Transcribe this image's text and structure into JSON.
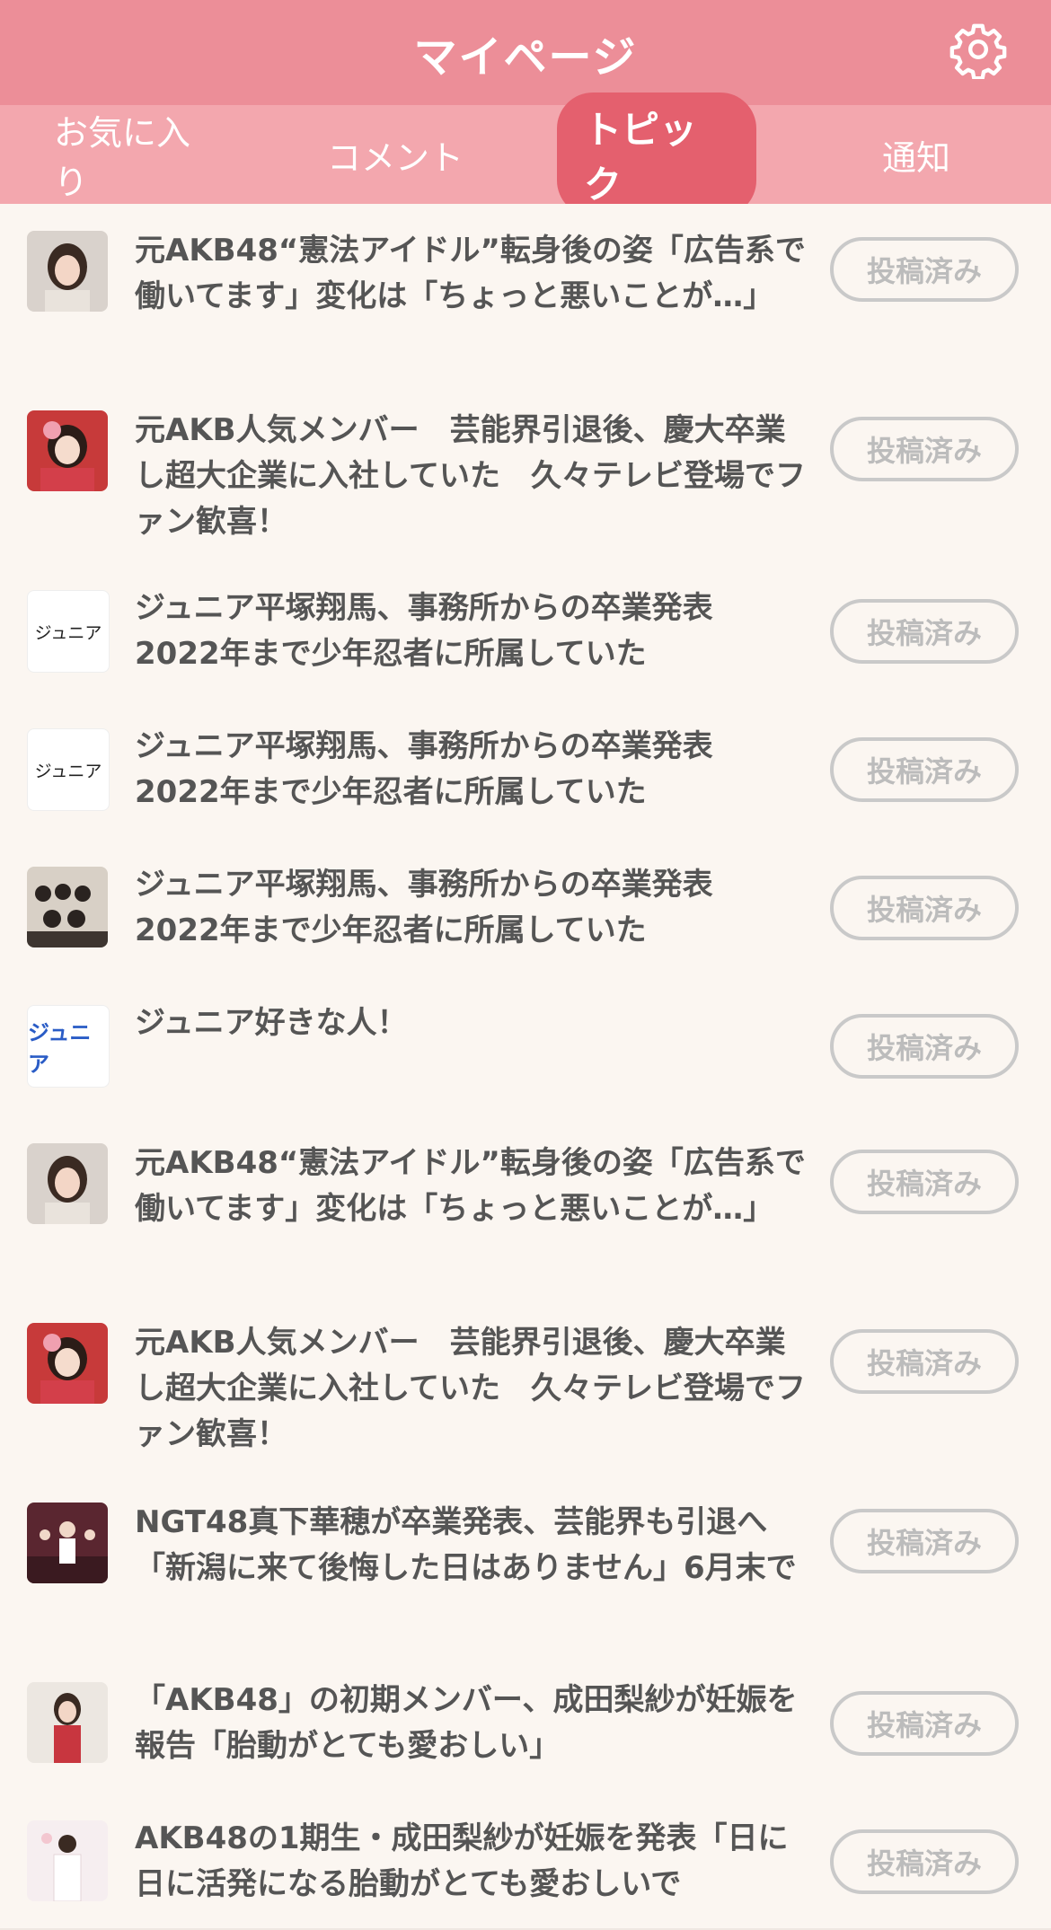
{
  "header": {
    "title": "マイページ",
    "settings_icon": "gear-icon"
  },
  "tabs": [
    {
      "label": "お気に入り",
      "active": false
    },
    {
      "label": "コメント",
      "active": false
    },
    {
      "label": "トピック",
      "active": true
    },
    {
      "label": "通知",
      "active": false
    }
  ],
  "colors": {
    "header": "#ec8e98",
    "tabbar": "#f3a7ae",
    "active_tab": "#e4606e"
  },
  "topics": [
    {
      "title": "元AKB48“憲法アイドル”転身後の姿「広告系で働いてます」変化は「ちょっと悪いことが…」",
      "button": "投稿済み",
      "thumb": "portrait-photo"
    },
    {
      "title": "元AKB人気メンバー　芸能界引退後、慶大卒業し超大企業に入社していた　久々テレビ登場でファン歓喜！",
      "button": "投稿済み",
      "thumb": "portrait-photo"
    },
    {
      "title": "ジュニア平塚翔馬、事務所からの卒業発表 2022年まで少年忍者に所属していた",
      "button": "投稿済み",
      "thumb_text": "ジュニア"
    },
    {
      "title": "ジュニア平塚翔馬、事務所からの卒業発表 2022年まで少年忍者に所属していた",
      "button": "投稿済み",
      "thumb_text": "ジュニア"
    },
    {
      "title": "ジュニア平塚翔馬、事務所からの卒業発表 2022年まで少年忍者に所属していた",
      "button": "投稿済み",
      "thumb": "group-photo"
    },
    {
      "title": "ジュニア好きな人！",
      "button": "投稿済み",
      "thumb_text": "ジュニア"
    },
    {
      "title": "元AKB48“憲法アイドル”転身後の姿「広告系で働いてます」変化は「ちょっと悪いことが…」",
      "button": "投稿済み",
      "thumb": "portrait-photo"
    },
    {
      "title": "元AKB人気メンバー　芸能界引退後、慶大卒業し超大企業に入社していた　久々テレビ登場でファン歓喜！",
      "button": "投稿済み",
      "thumb": "portrait-photo"
    },
    {
      "title": "NGT48真下華穂が卒業発表、芸能界も引退へ「新潟に来て後悔した日はありません」6月末で",
      "button": "投稿済み",
      "thumb": "stage-photo"
    },
    {
      "title": "「AKB48」の初期メンバー、成田梨紗が妊娠を報告「胎動がとても愛おしい」",
      "button": "投稿済み",
      "thumb": "portrait-photo"
    },
    {
      "title": "AKB48の1期生・成田梨紗が妊娠を発表「日に日に活発になる胎動がとても愛おしいで",
      "button": "投稿済み",
      "thumb": "portrait-photo"
    }
  ]
}
